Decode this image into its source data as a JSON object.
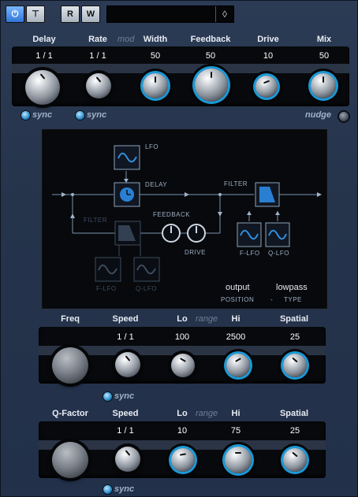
{
  "toolbar": {
    "power_icon": "power-icon",
    "r_label": "R",
    "w_label": "W",
    "preset_arrow": "◊"
  },
  "delay_section": {
    "labels": {
      "delay": "Delay",
      "rate": "Rate",
      "mod": "mod",
      "width": "Width",
      "feedback": "Feedback",
      "drive": "Drive",
      "mix": "Mix"
    },
    "values": {
      "delay": "1 / 1",
      "rate": "1 / 1",
      "width": "50",
      "feedback": "50",
      "drive": "10",
      "mix": "50"
    },
    "sync_delay": "sync",
    "sync_rate": "sync",
    "nudge": "nudge"
  },
  "diagram": {
    "lfo": "LFO",
    "delay": "DELAY",
    "filter_right": "FILTER",
    "filter_left": "FILTER",
    "feedback": "FEEDBACK",
    "drive": "DRIVE",
    "f_lfo_right": "F-LFO",
    "q_lfo_right": "Q-LFO",
    "f_lfo_left": "F-LFO",
    "q_lfo_left": "Q-LFO",
    "position_value": "output",
    "type_value": "lowpass",
    "position_label": "POSITION",
    "dash": "-",
    "type_label": "TYPE"
  },
  "freq_section": {
    "labels": {
      "freq": "Freq",
      "speed": "Speed",
      "lo": "Lo",
      "range": "range",
      "hi": "Hi",
      "spatial": "Spatial"
    },
    "values": {
      "speed": "1 / 1",
      "lo": "100",
      "hi": "2500",
      "spatial": "25"
    },
    "sync": "sync"
  },
  "q_section": {
    "labels": {
      "qfactor": "Q-Factor",
      "speed": "Speed",
      "lo": "Lo",
      "range": "range",
      "hi": "Hi",
      "spatial": "Spatial"
    },
    "values": {
      "speed": "1 / 1",
      "lo": "10",
      "hi": "75",
      "spatial": "25"
    },
    "sync": "sync"
  },
  "colors": {
    "accent": "#1a9ad8",
    "panel": "#25344b",
    "display": "#07090c"
  }
}
